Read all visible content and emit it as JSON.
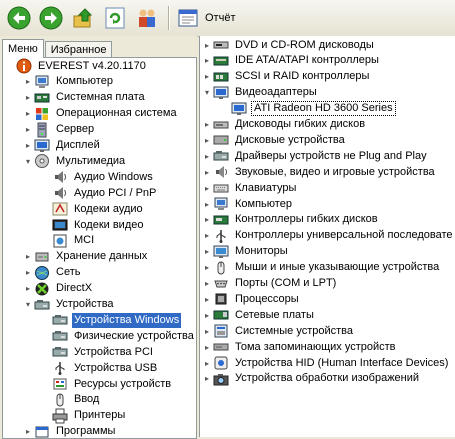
{
  "toolbar": {
    "back_icon": "back-arrow-icon",
    "forward_icon": "forward-arrow-icon",
    "up_icon": "up-folder-icon",
    "refresh_icon": "refresh-icon",
    "users_icon": "users-icon",
    "report_label": "Отчёт"
  },
  "tabs": [
    "Меню",
    "Избранное"
  ],
  "left_tree": [
    {
      "label": "EVEREST v4.20.1170",
      "icon": "info-icon"
    },
    {
      "label": "Компьютер",
      "icon": "computer-icon"
    },
    {
      "label": "Системная плата",
      "icon": "motherboard-icon"
    },
    {
      "label": "Операционная система",
      "icon": "windows-icon"
    },
    {
      "label": "Сервер",
      "icon": "server-icon"
    },
    {
      "label": "Дисплей",
      "icon": "display-icon"
    },
    {
      "label": "Мультимедиа",
      "icon": "multimedia-icon"
    },
    {
      "label": "Аудио Windows",
      "icon": "speaker-icon"
    },
    {
      "label": "Аудио PCI / PnP",
      "icon": "speaker-icon"
    },
    {
      "label": "Кодеки аудио",
      "icon": "audio-codec-icon"
    },
    {
      "label": "Кодеки видео",
      "icon": "video-codec-icon"
    },
    {
      "label": "MCI",
      "icon": "mci-icon"
    },
    {
      "label": "Хранение данных",
      "icon": "storage-icon"
    },
    {
      "label": "Сеть",
      "icon": "network-icon"
    },
    {
      "label": "DirectX",
      "icon": "directx-icon"
    },
    {
      "label": "Устройства",
      "icon": "devices-icon"
    },
    {
      "label": "Устройства Windows",
      "icon": "devices-icon"
    },
    {
      "label": "Физические устройства",
      "icon": "devices-icon"
    },
    {
      "label": "Устройства PCI",
      "icon": "devices-icon"
    },
    {
      "label": "Устройства USB",
      "icon": "usb-icon"
    },
    {
      "label": "Ресурсы устройств",
      "icon": "resources-icon"
    },
    {
      "label": "Ввод",
      "icon": "mouse-icon"
    },
    {
      "label": "Принтеры",
      "icon": "printer-icon"
    },
    {
      "label": "Программы",
      "icon": "programs-icon"
    }
  ],
  "right_tree": [
    {
      "label": "DVD и CD-ROM дисководы",
      "icon": "cdrom-icon"
    },
    {
      "label": "IDE ATA/ATAPI контроллеры",
      "icon": "ide-controller-icon"
    },
    {
      "label": "SCSI и RAID контроллеры",
      "icon": "scsi-icon"
    },
    {
      "label": "Видеоадаптеры",
      "icon": "display-adapter-icon"
    },
    {
      "label": "ATI Radeon HD 3600 Series",
      "icon": "display-adapter-icon"
    },
    {
      "label": "Дисководы гибких дисков",
      "icon": "floppy-icon"
    },
    {
      "label": "Дисковые устройства",
      "icon": "disk-icon"
    },
    {
      "label": "Драйверы устройств не Plug and Play",
      "icon": "devices-icon"
    },
    {
      "label": "Звуковые, видео и игровые устройства",
      "icon": "sound-icon"
    },
    {
      "label": "Клавиатуры",
      "icon": "keyboard-icon"
    },
    {
      "label": "Компьютер",
      "icon": "computer-icon"
    },
    {
      "label": "Контроллеры гибких дисков",
      "icon": "floppy-controller-icon"
    },
    {
      "label": "Контроллеры универсальной последовате",
      "icon": "usb-icon"
    },
    {
      "label": "Мониторы",
      "icon": "monitor-icon"
    },
    {
      "label": "Мыши и иные указывающие устройства",
      "icon": "mouse-icon"
    },
    {
      "label": "Порты (COM и LPT)",
      "icon": "port-icon"
    },
    {
      "label": "Процессоры",
      "icon": "processor-icon"
    },
    {
      "label": "Сетевые платы",
      "icon": "network-card-icon"
    },
    {
      "label": "Системные устройства",
      "icon": "system-icon"
    },
    {
      "label": "Тома запоминающих устройств",
      "icon": "volume-icon"
    },
    {
      "label": "Устройства HID (Human Interface Devices)",
      "icon": "hid-icon"
    },
    {
      "label": "Устройства обработки изображений",
      "icon": "camera-icon"
    }
  ],
  "colors": {
    "selection": "#316ac5",
    "toolbar_bg": "#ece9d8",
    "nav_green": "#3aa22f"
  }
}
